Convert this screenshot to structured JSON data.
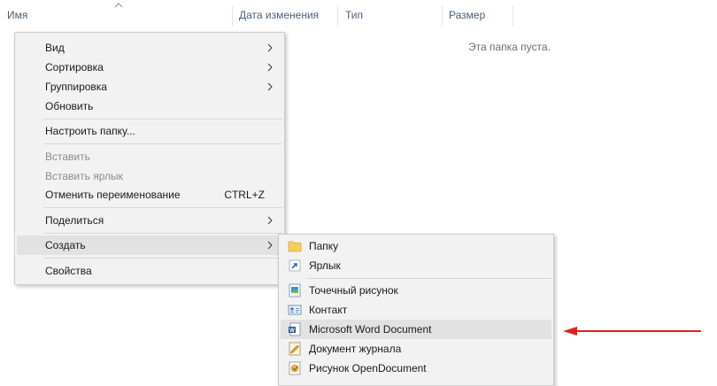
{
  "columns": {
    "name": "Имя",
    "date_modified": "Дата изменения",
    "type": "Тип",
    "size": "Размер"
  },
  "empty_message": "Эта папка пуста.",
  "context_menu": {
    "view": "Вид",
    "sort": "Сортировка",
    "group": "Группировка",
    "refresh": "Обновить",
    "customize_folder": "Настроить папку...",
    "paste": "Вставить",
    "paste_shortcut": "Вставить ярлык",
    "undo_rename": "Отменить переименование",
    "undo_rename_shortcut": "CTRL+Z",
    "share": "Поделиться",
    "create": "Создать",
    "properties": "Свойства"
  },
  "create_submenu": {
    "folder": "Папку",
    "shortcut": "Ярлык",
    "bitmap": "Точечный рисунок",
    "contact": "Контакт",
    "word_document": "Microsoft Word Document",
    "journal_document": "Документ журнала",
    "open_document_drawing": "Рисунок OpenDocument"
  },
  "colors": {
    "menu_bg": "#f2f2f2",
    "hover": "#e2e2e2",
    "annotation_arrow": "#e02020",
    "header_text": "#4c607a"
  }
}
